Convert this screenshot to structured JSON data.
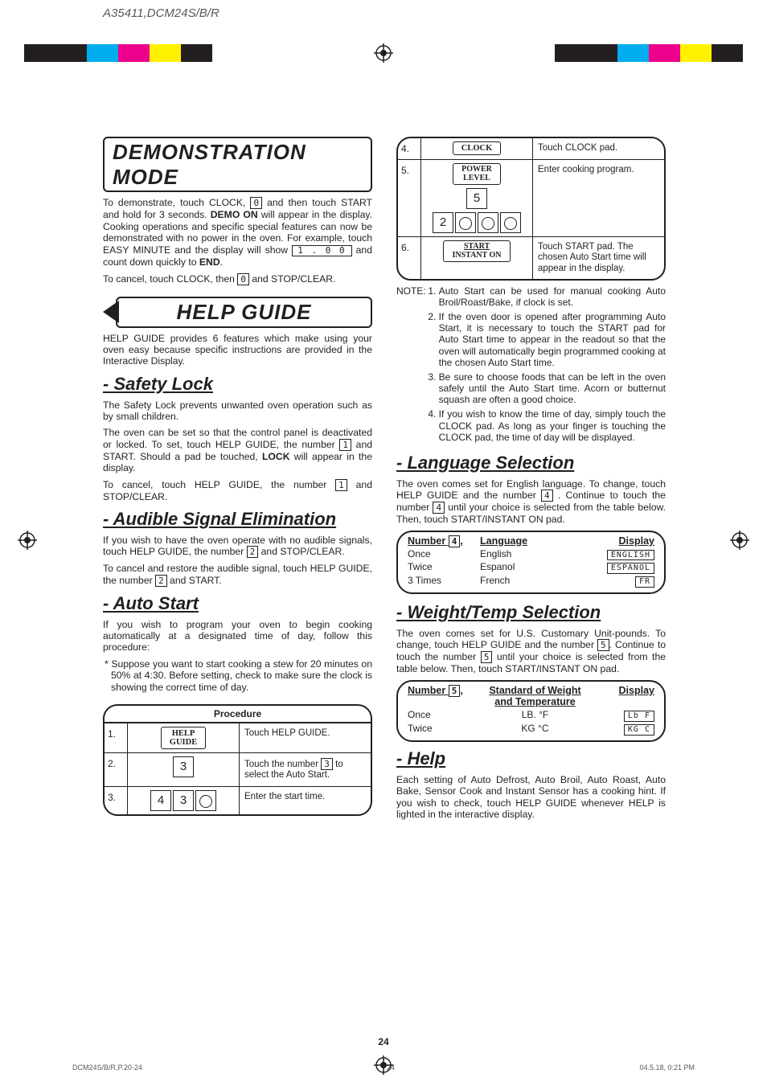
{
  "header": {
    "model": "A35411,DCM24S/B/R"
  },
  "colorbar": {
    "left": [
      "#231f20",
      "#231f20",
      "#00adee",
      "#ed008c",
      "#fff100",
      "#231f20"
    ],
    "right": [
      "#231f20",
      "#231f20",
      "#00adee",
      "#ed008c",
      "#fff100",
      "#231f20"
    ]
  },
  "demo": {
    "title": "DEMONSTRATION MODE",
    "p1a": "To demonstrate, touch CLOCK, ",
    "p1key": "0",
    "p1b": " and then touch START and hold for 3 seconds. ",
    "p1c": "DEMO ON",
    "p1d": " will appear in the display. Cooking operations and specific special features can now be demonstrated with no power in the oven. For example, touch EASY MINUTE and the display will show ",
    "p1lcd": "1 . 0 0",
    "p1e": " and count down quickly to ",
    "p1f": "END",
    "p1g": ".",
    "p2a": "To cancel, touch CLOCK, then ",
    "p2key": "0",
    "p2b": " and STOP/CLEAR."
  },
  "helpguide": {
    "title": "HELP GUIDE",
    "intro": "HELP GUIDE provides 6 features which make using your oven easy because specific instructions are provided in the Interactive Display."
  },
  "safety": {
    "title": "- Safety Lock",
    "p1": "The Safety Lock prevents unwanted oven operation such as by small children.",
    "p2a": "The oven can be set so that the control panel is deactivated or locked. To set, touch HELP GUIDE, the number ",
    "p2key": "1",
    "p2b": " and START. Should a pad be touched, ",
    "p2c": "LOCK",
    "p2d": " will appear in the display.",
    "p3a": "To cancel, touch HELP GUIDE, the number ",
    "p3key": "1",
    "p3b": " and STOP/CLEAR."
  },
  "audible": {
    "title": "- Audible Signal Elimination",
    "p1a": "If you wish to have the oven operate with no audible signals, touch HELP GUIDE, the number ",
    "p1key": "2",
    "p1b": " and STOP/CLEAR.",
    "p2a": "To cancel and restore the audible signal, touch HELP GUIDE, the number ",
    "p2key": "2",
    "p2b": " and START."
  },
  "autostart": {
    "title": "- Auto Start",
    "p1": "If you wish to program your oven to begin cooking automatically at a designated time of day, follow this procedure:",
    "p2": "Suppose you want to start cooking a stew for 20 minutes on 50% at 4:30. Before setting, check to make sure the clock is showing the correct time of day.",
    "proc_title": "Procedure",
    "steps": [
      {
        "n": "1.",
        "btn": "HELP\nGUIDE",
        "desc": "Touch HELP GUIDE."
      },
      {
        "n": "2.",
        "btn_num": "3",
        "desc_a": "Touch the number ",
        "desc_key": "3",
        "desc_b": " to select the Auto Start."
      },
      {
        "n": "3.",
        "nums": [
          "4",
          "3",
          "○"
        ],
        "desc": "Enter the start time."
      }
    ]
  },
  "rightsteps": [
    {
      "n": "4.",
      "btn": "CLOCK",
      "desc": "Touch CLOCK pad."
    },
    {
      "n": "5.",
      "btn": "POWER\nLEVEL",
      "num_below": "5",
      "row2": [
        "2",
        "○",
        "○",
        "○"
      ],
      "desc": "Enter cooking program."
    },
    {
      "n": "6.",
      "btn_lines": [
        "START",
        "INSTANT ON"
      ],
      "desc": "Touch START pad. The chosen Auto Start time will appear in the display."
    }
  ],
  "notes": {
    "label": "NOTE:",
    "items": [
      "Auto Start can be used for manual cooking Auto Broil/Roast/Bake, if clock is set.",
      "If the oven door is opened after programming Auto Start, it is necessary to touch the START pad for Auto Start time to appear in the readout so that the oven will automatically begin programmed cooking at the chosen Auto Start time.",
      "Be sure to choose foods that can be left in the oven safely until the Auto Start time. Acorn or butternut squash are often a good choice.",
      "If you wish to know the time of day, simply touch the CLOCK pad. As long as your finger is touching the CLOCK pad, the time of day will be displayed."
    ]
  },
  "language": {
    "title": "- Language Selection",
    "p1a": "The oven comes set for English language. To change, touch HELP GUIDE and the number ",
    "p1key": "4",
    "p1b": " . Continue to touch  the number ",
    "p1key2": "4",
    "p1c": " until your choice is selected from the table below. Then, touch START/INSTANT ON pad.",
    "head": {
      "c1a": "Number ",
      "c1key": "4",
      "c1b": ",",
      "c2": "Language",
      "c3": "Display"
    },
    "rows": [
      {
        "c1": "Once",
        "c2": "English",
        "c3": "ENGLISH"
      },
      {
        "c1": "Twice",
        "c2": "Espanol",
        "c3": "ESPANOL"
      },
      {
        "c1": "3 Times",
        "c2": "French",
        "c3": "FR"
      }
    ]
  },
  "weight": {
    "title": "- Weight/Temp Selection",
    "p1a": "The oven comes set for U.S. Customary Unit-pounds. To change, touch HELP GUIDE and the number ",
    "p1key": "5",
    "p1b": ". Continue to touch the number ",
    "p1key2": "5",
    "p1c": " until your choice is selected from the table below. Then, touch START/INSTANT ON pad.",
    "head": {
      "c1a": "Number ",
      "c1key": "5",
      "c1b": ",",
      "c2": "Standard of Weight\nand Temperature",
      "c3": "Display"
    },
    "rows": [
      {
        "c1": "Once",
        "c2": "LB. °F",
        "c3": "Lb F"
      },
      {
        "c1": "Twice",
        "c2": "KG °C",
        "c3": "KG C"
      }
    ]
  },
  "help": {
    "title": "- Help",
    "p1": "Each setting of Auto Defrost, Auto Broil, Auto Roast, Auto Bake, Sensor Cook and  Instant Sensor has a cooking hint. If you wish to check, touch HELP GUIDE whenever HELP is lighted in the interactive display."
  },
  "pagenum": "24",
  "footer": {
    "left": "DCM24S/B/R,P.20-24",
    "mid": "24",
    "right": "04.5.18, 0:21 PM"
  }
}
